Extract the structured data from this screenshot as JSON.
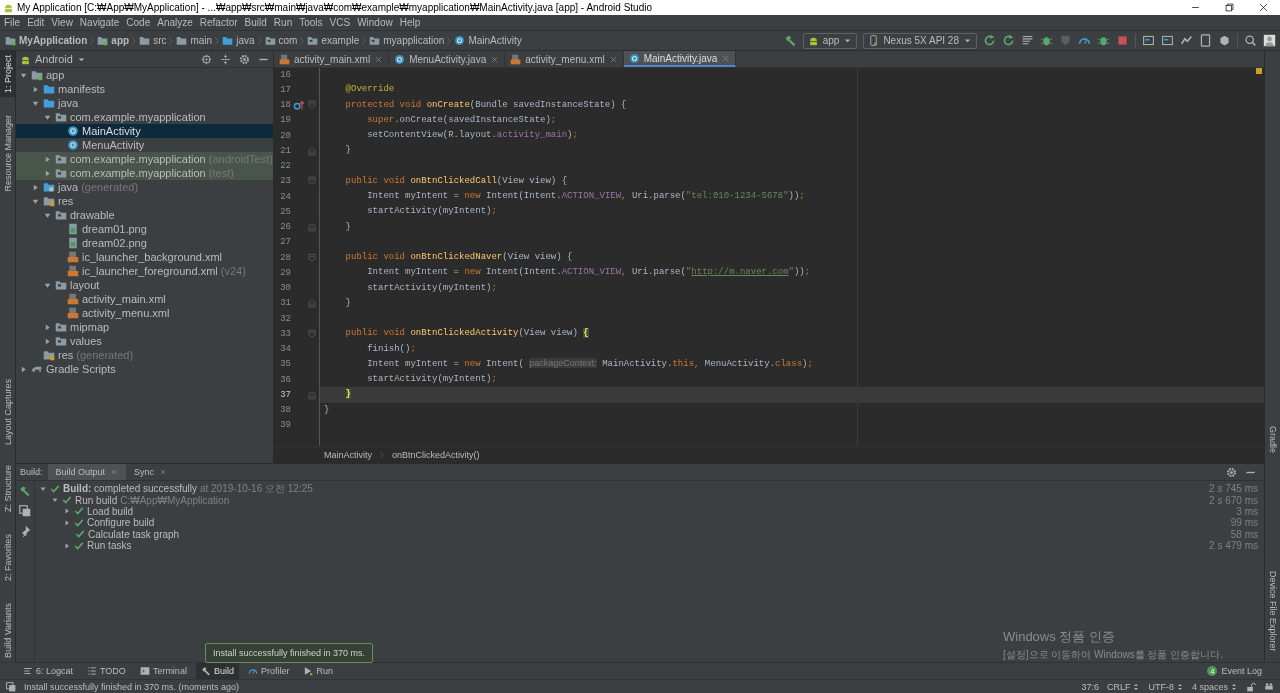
{
  "window": {
    "title": "My Application [C:₩App₩MyApplication] - ...₩app₩src₩main₩java₩com₩example₩myapplication₩MainActivity.java [app] - Android Studio"
  },
  "menu": [
    "File",
    "Edit",
    "View",
    "Navigate",
    "Code",
    "Analyze",
    "Refactor",
    "Build",
    "Run",
    "Tools",
    "VCS",
    "Window",
    "Help"
  ],
  "breadcrumb": [
    {
      "label": "MyApplication",
      "kind": "project"
    },
    {
      "label": "app",
      "kind": "module"
    },
    {
      "label": "src",
      "kind": "folder"
    },
    {
      "label": "main",
      "kind": "folder"
    },
    {
      "label": "java",
      "kind": "src-folder"
    },
    {
      "label": "com",
      "kind": "package"
    },
    {
      "label": "example",
      "kind": "package"
    },
    {
      "label": "myapplication",
      "kind": "package"
    },
    {
      "label": "MainActivity",
      "kind": "class"
    }
  ],
  "run_config": {
    "module": "app",
    "device": "Nexus 5X API 28"
  },
  "side_tabs": {
    "left_upper": [
      {
        "label": "1: Project",
        "selected": true
      },
      {
        "label": "Resource Manager",
        "selected": false
      },
      {
        "label": "Layout Captures",
        "selected": false
      }
    ],
    "left_lower": [
      {
        "label": "Z: Structure",
        "selected": false
      },
      {
        "label": "2: Favorites",
        "selected": false
      },
      {
        "label": "Build Variants",
        "selected": false
      }
    ],
    "right_upper": [
      {
        "label": "Gradle",
        "selected": false
      }
    ],
    "right_lower": [
      {
        "label": "Device File Explorer",
        "selected": false
      }
    ]
  },
  "project_panel": {
    "view": "Android",
    "tree": [
      {
        "label": "app",
        "kind": "module",
        "expanded": true,
        "selected": false,
        "children": [
          {
            "label": "manifests",
            "kind": "src-folder",
            "expanded": false,
            "selected": false
          },
          {
            "label": "java",
            "kind": "src-folder",
            "expanded": true,
            "selected": false,
            "children": [
              {
                "label": "com.example.myapplication",
                "kind": "package",
                "expanded": true,
                "selected": false,
                "children": [
                  {
                    "label": "MainActivity",
                    "kind": "class",
                    "selected": true
                  },
                  {
                    "label": "MenuActivity",
                    "kind": "class",
                    "selected": false
                  }
                ]
              },
              {
                "label": "com.example.myapplication",
                "suffix": "(androidTest)",
                "kind": "test-package",
                "expanded": false,
                "selected": false
              },
              {
                "label": "com.example.myapplication",
                "suffix": "(test)",
                "kind": "test-package",
                "expanded": false,
                "selected": false
              }
            ]
          },
          {
            "label": "java",
            "suffix": "(generated)",
            "kind": "generated",
            "expanded": false,
            "selected": false
          },
          {
            "label": "res",
            "kind": "res-folder",
            "expanded": true,
            "selected": false,
            "children": [
              {
                "label": "drawable",
                "kind": "package",
                "expanded": true,
                "selected": false,
                "children": [
                  {
                    "label": "dream01.png",
                    "kind": "image",
                    "selected": false
                  },
                  {
                    "label": "dream02.png",
                    "kind": "image",
                    "selected": false
                  },
                  {
                    "label": "ic_launcher_background.xml",
                    "kind": "xml",
                    "selected": false
                  },
                  {
                    "label": "ic_launcher_foreground.xml",
                    "suffix": "(v24)",
                    "kind": "xml",
                    "selected": false
                  }
                ]
              },
              {
                "label": "layout",
                "kind": "package",
                "expanded": true,
                "selected": false,
                "children": [
                  {
                    "label": "activity_main.xml",
                    "kind": "xml",
                    "selected": false
                  },
                  {
                    "label": "activity_menu.xml",
                    "kind": "xml",
                    "selected": false
                  }
                ]
              },
              {
                "label": "mipmap",
                "kind": "package",
                "expanded": false,
                "selected": false
              },
              {
                "label": "values",
                "kind": "package",
                "expanded": false,
                "selected": false
              }
            ]
          },
          {
            "label": "res",
            "suffix": "(generated)",
            "kind": "res-folder",
            "selected": false
          }
        ]
      },
      {
        "label": "Gradle Scripts",
        "kind": "gradle",
        "expanded": false,
        "selected": false
      }
    ]
  },
  "editor": {
    "tabs": [
      {
        "label": "activity_main.xml",
        "kind": "xml",
        "selected": false
      },
      {
        "label": "MenuActivity.java",
        "kind": "class",
        "selected": false
      },
      {
        "label": "activity_menu.xml",
        "kind": "xml",
        "selected": false
      },
      {
        "label": "MainActivity.java",
        "kind": "class",
        "selected": true
      }
    ],
    "lines": [
      {
        "n": "16",
        "current": false
      },
      {
        "n": "17",
        "current": false,
        "tokens": [
          {
            "kind": "annotation",
            "text": "    @Override"
          }
        ]
      },
      {
        "n": "18",
        "current": false,
        "override_marker": true,
        "fold_start": true,
        "tokens": [
          {
            "kind": "keyword",
            "text": "    protected void "
          },
          {
            "kind": "method",
            "text": "onCreate"
          },
          {
            "kind": "plain",
            "text": "(Bundle savedInstanceState) {"
          }
        ]
      },
      {
        "n": "19",
        "current": false,
        "tokens": [
          {
            "kind": "keyword",
            "text": "        super"
          },
          {
            "kind": "plain",
            "text": ".onCreate(savedInstanceState)"
          },
          {
            "kind": "keyword",
            "text": ";"
          }
        ]
      },
      {
        "n": "20",
        "current": false,
        "tokens": [
          {
            "kind": "plain",
            "text": "        setContentView(R.layout."
          },
          {
            "kind": "field",
            "text": "activity_main"
          },
          {
            "kind": "plain",
            "text": ")"
          },
          {
            "kind": "keyword",
            "text": ";"
          }
        ]
      },
      {
        "n": "21",
        "current": false,
        "fold_end": true,
        "tokens": [
          {
            "kind": "plain",
            "text": "    }"
          }
        ]
      },
      {
        "n": "22",
        "current": false
      },
      {
        "n": "23",
        "current": false,
        "fold_start": true,
        "tokens": [
          {
            "kind": "keyword",
            "text": "    public void "
          },
          {
            "kind": "method",
            "text": "onBtnClickedCall"
          },
          {
            "kind": "plain",
            "text": "(View view) {"
          }
        ]
      },
      {
        "n": "24",
        "current": false,
        "tokens": [
          {
            "kind": "plain",
            "text": "        Intent myIntent = "
          },
          {
            "kind": "keyword",
            "text": "new "
          },
          {
            "kind": "plain",
            "text": "Intent(Intent."
          },
          {
            "kind": "field",
            "text": "ACTION_VIEW"
          },
          {
            "kind": "keyword",
            "text": ", "
          },
          {
            "kind": "plain",
            "text": "Uri.parse("
          },
          {
            "kind": "string",
            "text": "\"tel:010-1234-5678\""
          },
          {
            "kind": "plain",
            "text": "))"
          },
          {
            "kind": "keyword",
            "text": ";"
          }
        ]
      },
      {
        "n": "25",
        "current": false,
        "tokens": [
          {
            "kind": "plain",
            "text": "        startActivity(myIntent)"
          },
          {
            "kind": "keyword",
            "text": ";"
          }
        ]
      },
      {
        "n": "26",
        "current": false,
        "fold_end": true,
        "tokens": [
          {
            "kind": "plain",
            "text": "    }"
          }
        ]
      },
      {
        "n": "27",
        "current": false
      },
      {
        "n": "28",
        "current": false,
        "fold_start": true,
        "tokens": [
          {
            "kind": "keyword",
            "text": "    public void "
          },
          {
            "kind": "method",
            "text": "onBtnClickedNaver"
          },
          {
            "kind": "plain",
            "text": "(View view) {"
          }
        ]
      },
      {
        "n": "29",
        "current": false,
        "tokens": [
          {
            "kind": "plain",
            "text": "        Intent myIntent = "
          },
          {
            "kind": "keyword",
            "text": "new "
          },
          {
            "kind": "plain",
            "text": "Intent(Intent."
          },
          {
            "kind": "field",
            "text": "ACTION_VIEW"
          },
          {
            "kind": "keyword",
            "text": ", "
          },
          {
            "kind": "plain",
            "text": "Uri.parse("
          },
          {
            "kind": "string",
            "text": "\""
          },
          {
            "kind": "link",
            "text": "http://m.naver.com"
          },
          {
            "kind": "string",
            "text": "\""
          },
          {
            "kind": "plain",
            "text": "))"
          },
          {
            "kind": "keyword",
            "text": ";"
          }
        ]
      },
      {
        "n": "30",
        "current": false,
        "tokens": [
          {
            "kind": "plain",
            "text": "        startActivity(myIntent)"
          },
          {
            "kind": "keyword",
            "text": ";"
          }
        ]
      },
      {
        "n": "31",
        "current": false,
        "fold_end": true,
        "tokens": [
          {
            "kind": "plain",
            "text": "    }"
          }
        ]
      },
      {
        "n": "32",
        "current": false
      },
      {
        "n": "33",
        "current": false,
        "fold_start": true,
        "tokens": [
          {
            "kind": "keyword",
            "text": "    public void "
          },
          {
            "kind": "method",
            "text": "onBtnClickedActivity"
          },
          {
            "kind": "plain",
            "text": "(View view) "
          },
          {
            "kind": "brace",
            "text": "{"
          }
        ]
      },
      {
        "n": "34",
        "current": false,
        "tokens": [
          {
            "kind": "plain",
            "text": "        finish()"
          },
          {
            "kind": "keyword",
            "text": ";"
          }
        ]
      },
      {
        "n": "35",
        "current": false,
        "tokens": [
          {
            "kind": "plain",
            "text": "        Intent myIntent = "
          },
          {
            "kind": "keyword",
            "text": "new "
          },
          {
            "kind": "plain",
            "text": "Intent( "
          },
          {
            "kind": "hint",
            "text": "packageContext:"
          },
          {
            "kind": "plain",
            "text": " MainActivity."
          },
          {
            "kind": "keyword",
            "text": "this, "
          },
          {
            "kind": "plain",
            "text": "MenuActivity."
          },
          {
            "kind": "keyword",
            "text": "class"
          },
          {
            "kind": "plain",
            "text": ")"
          },
          {
            "kind": "keyword",
            "text": ";"
          }
        ]
      },
      {
        "n": "36",
        "current": false,
        "tokens": [
          {
            "kind": "plain",
            "text": "        startActivity(myIntent)"
          },
          {
            "kind": "keyword",
            "text": ";"
          }
        ]
      },
      {
        "n": "37",
        "current": true,
        "fold_end": true,
        "tokens": [
          {
            "kind": "brace",
            "text": "    }"
          }
        ]
      },
      {
        "n": "38",
        "current": false,
        "tokens": [
          {
            "kind": "plain",
            "text": "}"
          }
        ]
      },
      {
        "n": "39",
        "current": false
      }
    ],
    "breadcrumb": [
      "MainActivity",
      "onBtnClickedActivity()"
    ]
  },
  "build_panel": {
    "label": "Build:",
    "tabs": [
      {
        "label": "Build Output",
        "selected": true
      },
      {
        "label": "Sync",
        "selected": false
      }
    ],
    "rows": [
      {
        "label": "**Build:** completed successfully",
        "note": "at 2019-10-16 오전 12:25",
        "time": "2 s 745 ms",
        "expanded": true,
        "children": [
          {
            "label": "Run build",
            "note": "C:₩App₩MyApplication",
            "time": "2 s 670 ms",
            "expanded": true,
            "children": [
              {
                "label": "Load build",
                "time": "3 ms",
                "expanded": false
              },
              {
                "label": "Configure build",
                "time": "99 ms",
                "expanded": false
              },
              {
                "label": "Calculate task graph",
                "time": "58 ms"
              },
              {
                "label": "Run tasks",
                "time": "2 s 479 ms",
                "expanded": false
              }
            ]
          }
        ]
      }
    ]
  },
  "activation_notice": {
    "title": "Windows 정품 인증",
    "message": "[설정]으로 이동하여 Windows를 정품 인증합니다."
  },
  "tool_windows": [
    {
      "label": "6: Logcat",
      "kind": "logcat",
      "selected": false
    },
    {
      "label": "TODO",
      "kind": "todo",
      "selected": false
    },
    {
      "label": "Terminal",
      "kind": "terminal",
      "selected": false
    },
    {
      "label": "Build",
      "kind": "build",
      "selected": true
    },
    {
      "label": "Profiler",
      "kind": "profiler",
      "selected": false
    },
    {
      "label": "Run",
      "kind": "run",
      "selected": false
    }
  ],
  "tooltip": "Install successfully finished in 370 ms.",
  "event_log": {
    "label": "Event Log",
    "count": "4"
  },
  "status_bar": {
    "message": "Install successfully finished in 370 ms. (moments ago)",
    "position": "37:6",
    "line_ending": "CRLF",
    "encoding": "UTF-8",
    "indent": "4 spaces"
  }
}
